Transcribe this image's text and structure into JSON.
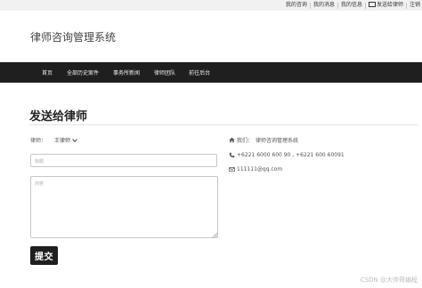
{
  "topbar": {
    "links": [
      "我的咨询",
      "我的消息",
      "我的信息",
      "发送给律师",
      "注销"
    ]
  },
  "brand": "律师咨询管理系统",
  "nav": {
    "items": [
      "首页",
      "全部历史案件",
      "事务所新闻",
      "律师团队",
      "前往后台"
    ]
  },
  "page": {
    "heading": "发送给律师"
  },
  "form": {
    "lawyer_label": "律师：",
    "lawyer_value": "王律师",
    "title_placeholder": "标题",
    "content_placeholder": "内容",
    "submit_label": "提交"
  },
  "sidebar_info": {
    "home_label": "我们：",
    "home_value": "律师咨询管理系统",
    "phone": "+6221 6000 600 90 , +6221 600 60091",
    "email": "111111@qq.com"
  },
  "icons": {
    "home": "home-icon",
    "phone": "phone-icon",
    "mail": "mail-icon"
  },
  "watermark": "CSDN @大帅哥编程"
}
